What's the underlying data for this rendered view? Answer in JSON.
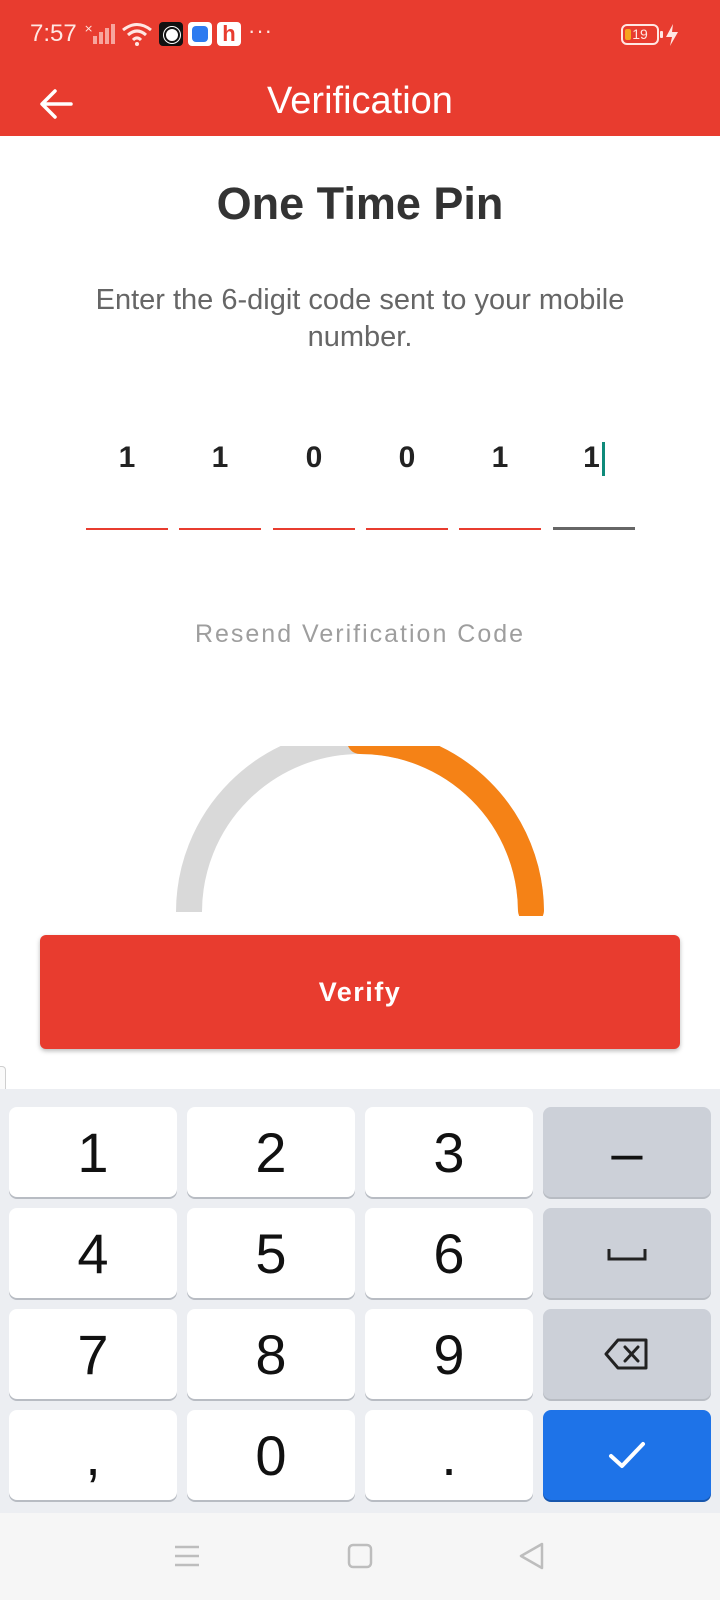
{
  "status_bar": {
    "time": "7:57",
    "more": "···",
    "battery": "19",
    "app_h_letter": "h"
  },
  "app_bar": {
    "title": "Verification",
    "back_icon": "arrow-left-icon"
  },
  "heading": "One Time Pin",
  "instructions": "Enter the 6-digit code sent to your mobile number.",
  "otp": {
    "digits": [
      "1",
      "1",
      "0",
      "0",
      "1",
      "1"
    ],
    "active_index": 5
  },
  "resend_label": "Resend Verification Code",
  "verify_label": "Verify",
  "progress": {
    "fraction": 0.5,
    "track_color": "#d9d9d9",
    "fill_color": "#f58216"
  },
  "keyboard": {
    "row1": [
      "1",
      "2",
      "3",
      "–"
    ],
    "row2": [
      "4",
      "5",
      "6"
    ],
    "row3": [
      "7",
      "8",
      "9"
    ],
    "row4": [
      ",",
      "0",
      "."
    ],
    "space_icon": "space-bar-icon",
    "backspace_icon": "backspace-icon",
    "enter_icon": "checkmark-icon"
  },
  "colors": {
    "brand_red": "#e83c2f",
    "enter_blue": "#1e73e8"
  }
}
